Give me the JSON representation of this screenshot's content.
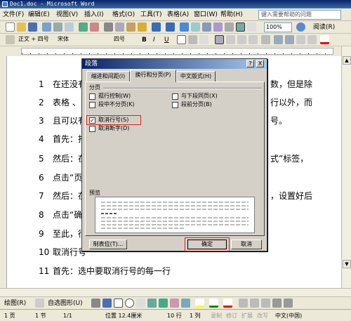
{
  "window": {
    "title": "Doc1.doc - Microsoft Word"
  },
  "menubar": {
    "items": [
      "文件(F)",
      "编辑(E)",
      "视图(V)",
      "插入(I)",
      "格式(O)",
      "工具(T)",
      "表格(A)",
      "窗口(W)",
      "帮助(H)"
    ],
    "help_placeholder": "键入需要帮助的问题"
  },
  "standard_toolbar": {
    "zoom": "100%",
    "read_label": "阅读(R)"
  },
  "format_toolbar": {
    "style": "正文 + 四号",
    "font": "宋体",
    "size": "四号",
    "bold": "B",
    "italic": "I",
    "underline": "U"
  },
  "document": {
    "lines": [
      {
        "num": "1",
        "text": "在还没有",
        "tail": "数，但是除"
      },
      {
        "num": "2",
        "text": "表格 、",
        "tail": "行以外，而"
      },
      {
        "num": "3",
        "text": "且可以有",
        "tail": "号。"
      },
      {
        "num": "4",
        "text": "首先：打",
        "tail": ""
      },
      {
        "num": "5",
        "text": "然后：在",
        "tail": "式”标签，"
      },
      {
        "num": "6",
        "text": "点击“页",
        "tail": ""
      },
      {
        "num": "7",
        "text": "然后：在",
        "tail": "，设置好后"
      },
      {
        "num": "8",
        "text": "点击“确",
        "tail": ""
      },
      {
        "num": "9",
        "text": "至此，行",
        "tail": ""
      },
      {
        "num": "10",
        "text": "取消行号",
        "tail": ""
      },
      {
        "num": "11",
        "text": "首先：选中要取消行号的每一行",
        "tail": ""
      }
    ]
  },
  "dialog": {
    "title": "段落",
    "help_btn": "?",
    "close_btn": "X",
    "tabs": [
      "缩进和间距(I)",
      "换行和分页(P)",
      "中文版式(H)"
    ],
    "active_tab": 1,
    "group_pagination": "分页",
    "options": [
      {
        "label": "孤行控制(W)",
        "checked": false
      },
      {
        "label": "与下段同页(X)",
        "checked": false
      },
      {
        "label": "段中不分页(K)",
        "checked": false
      },
      {
        "label": "段前分页(B)",
        "checked": false
      },
      {
        "label": "取消行号(S)",
        "checked": true
      },
      {
        "label": "取消断字(D)",
        "checked": false
      }
    ],
    "check_mark": "✓",
    "group_preview": "预览",
    "buttons": {
      "tabs": "制表位(T)...",
      "ok": "确定",
      "cancel": "取消"
    }
  },
  "drawbar": {
    "draw": "绘图(R)",
    "autoshape": "自选图形(U)"
  },
  "statusbar": {
    "page": "1 页",
    "section": "1 节",
    "pages": "1/1",
    "position": "位置 12.4厘米",
    "line": "10 行",
    "column": "1 列",
    "rec": "录制",
    "trk": "修订",
    "ext": "扩展",
    "ovr": "改写",
    "lang": "中文(中国)"
  },
  "colors": {
    "accent": "#0a246a",
    "highlight": "#e02020"
  }
}
